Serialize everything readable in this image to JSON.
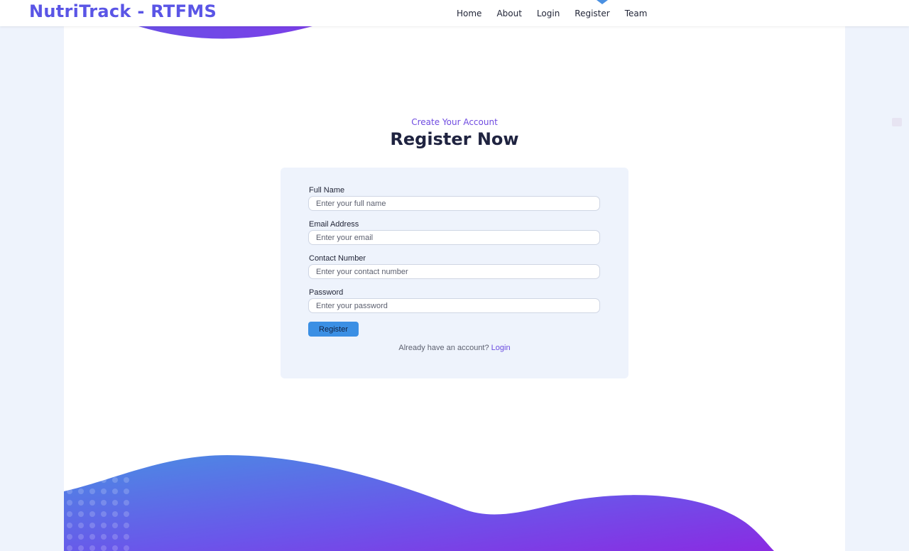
{
  "navbar": {
    "brand": "NutriTrack - RTFMS",
    "links": [
      "Home",
      "About",
      "Login",
      "Register",
      "Team"
    ],
    "active": "Register"
  },
  "hero": {
    "subtitle": "Create Your Account",
    "heading": "Register Now"
  },
  "form": {
    "fields": [
      {
        "label": "Full Name",
        "placeholder": "Enter your full name"
      },
      {
        "label": "Email Address",
        "placeholder": "Enter your email"
      },
      {
        "label": "Contact Number",
        "placeholder": "Enter your contact number"
      },
      {
        "label": "Password",
        "placeholder": "Enter your password"
      }
    ],
    "submit_label": "Register",
    "login_prompt": "Already have an account?",
    "login_link": "Login"
  },
  "colors": {
    "brand": "#5a55e6",
    "accent": "#6f4be0",
    "button": "#3b8fe4",
    "wave_start": "#4a90e2",
    "wave_end": "#8a2be2"
  }
}
